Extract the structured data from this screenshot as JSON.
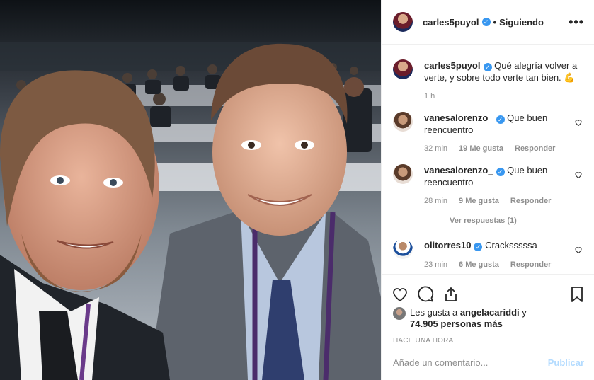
{
  "header": {
    "username": "carles5puyol",
    "dot": "•",
    "follow_status": "Siguiendo",
    "more": "•••"
  },
  "caption": {
    "username": "carles5puyol",
    "text": "Qué alegría volver a verte, y sobre todo verte tan bien. 💪",
    "time": "1 h"
  },
  "comments": [
    {
      "username": "vanesalorenzo_",
      "text": "Que buen reencuentro",
      "time": "32 min",
      "likes": "19 Me gusta",
      "reply": "Responder"
    },
    {
      "username": "vanesalorenzo_",
      "text": "Que buen reencuentro",
      "time": "28 min",
      "likes": "9 Me gusta",
      "reply": "Responder"
    },
    {
      "username": "olitorres10",
      "text": "Cracksssssa",
      "time": "23 min",
      "likes": "6 Me gusta",
      "reply": "Responder"
    }
  ],
  "view_replies": "Ver respuestas (1)",
  "likes": {
    "prefix": "Les gusta a ",
    "user": "angelacariddi",
    "middle": " y",
    "others": "74.905 personas más"
  },
  "posted_time": "HACE UNA HORA",
  "add_comment": {
    "placeholder": "Añade un comentario...",
    "publish": "Publicar"
  },
  "colors": {
    "verified": "#3897f0",
    "publish_disabled": "#b3dbff",
    "muted": "#8e8e8e"
  }
}
